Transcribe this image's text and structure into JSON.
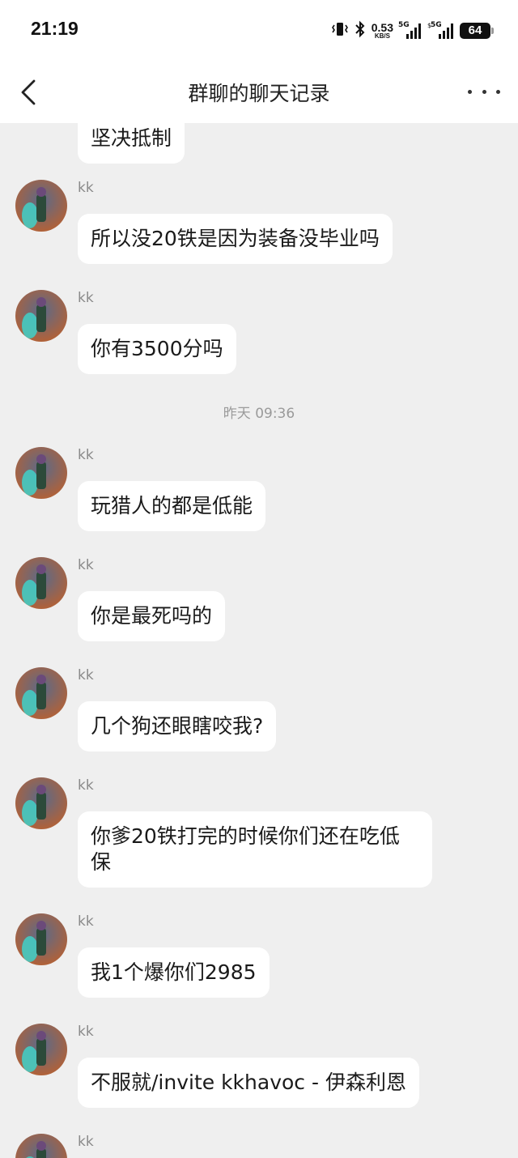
{
  "status_bar": {
    "time": "21:19",
    "net_speed_value": "0.53",
    "net_speed_unit": "KB/S",
    "sim1_label": "5G",
    "sim2_label": "5G",
    "battery_level": "64"
  },
  "header": {
    "title": "群聊的聊天记录",
    "back_icon": "chevron-left-icon",
    "more_icon": "more-horizontal-icon"
  },
  "timestamp_divider": "昨天 09:36",
  "messages": [
    {
      "sender": "",
      "text": "坚决抵制"
    },
    {
      "sender": "kk",
      "text": "所以没20铁是因为装备没毕业吗"
    },
    {
      "sender": "kk",
      "text": "你有3500分吗"
    },
    {
      "sender": "kk",
      "text": "玩猎人的都是低能"
    },
    {
      "sender": "kk",
      "text": "你是最死吗的"
    },
    {
      "sender": "kk",
      "text": "几个狗还眼瞎咬我?"
    },
    {
      "sender": "kk",
      "text": "你爹20铁打完的时候你们还在吃低保"
    },
    {
      "sender": "kk",
      "text": "我1个爆你们2985"
    },
    {
      "sender": "kk",
      "text": "不服就/invite kkhavoc - 伊森利恩"
    },
    {
      "sender": "kk",
      "text": ""
    }
  ],
  "colors": {
    "background": "#efefef",
    "bubble": "#ffffff",
    "sender_name": "#8a8a8a"
  }
}
